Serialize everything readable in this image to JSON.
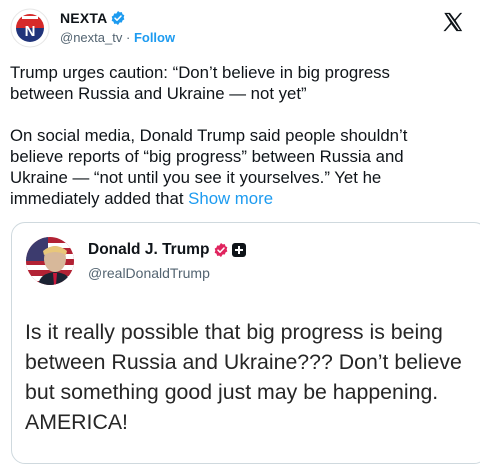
{
  "post": {
    "author_name": "NEXTA",
    "handle": "@nexta_tv",
    "separator": "·",
    "follow_label": "Follow",
    "headline": "Trump urges caution: “Don’t believe in big progress\nbetween Russia and Ukraine — not yet”",
    "body": "On social media, Donald Trump said people shouldn’t\nbelieve reports of “big progress” between Russia and\nUkraine — “not until you see it yourselves.” Yet he\nimmediately added that ",
    "show_more_label": "Show more"
  },
  "quoted": {
    "name": "Donald J. Trump",
    "handle": "@realDonaldTrump",
    "text": "Is it really possible that big progress is being\nbetween Russia and Ukraine??? Don’t believe\nbut something good just may be happening.\nAMERICA!"
  },
  "icons": {
    "avatar": "nexta-logo-icon",
    "verified": "verified-badge-icon",
    "close": "x-logo-icon",
    "quoted_badge": "red-verified-badge-icon",
    "quoted_square": "affiliation-badge-icon"
  },
  "colors": {
    "link": "#1d9bf0",
    "nexta_red": "#d62a2a",
    "nexta_blue": "#20347a",
    "trump_badge": "#e0245e"
  }
}
